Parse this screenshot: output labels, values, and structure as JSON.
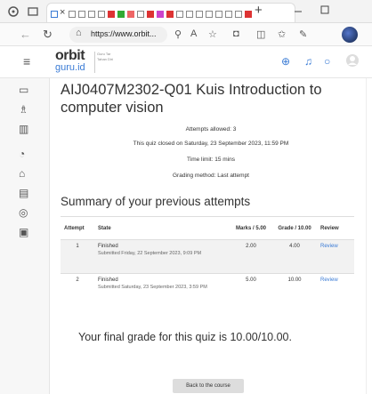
{
  "browser": {
    "tab_close": "×",
    "new_tab": "+",
    "url": "https://www.orbit..."
  },
  "site": {
    "logo_top": "orbit",
    "logo_bottom": "guru.id",
    "logo_tagline": "Guru Tar Tahan Diri"
  },
  "quiz": {
    "title": "AIJ0407M2302-Q01 Kuis Introduction to computer vision",
    "attempts_allowed": "Attempts allowed: 3",
    "closed_on": "This quiz closed on Saturday, 23 September 2023, 11:59 PM",
    "time_limit": "Time limit: 15 mins",
    "grading_method": "Grading method: Last attempt"
  },
  "summary": {
    "heading": "Summary of your previous attempts",
    "columns": [
      "Attempt",
      "State",
      "Marks / 5.00",
      "Grade / 10.00",
      "Review"
    ],
    "rows": [
      {
        "attempt": "1",
        "state": "Finished",
        "submitted": "Submitted Friday, 22 September 2023, 9:09 PM",
        "marks": "2.00",
        "grade": "4.00",
        "review": "Review"
      },
      {
        "attempt": "2",
        "state": "Finished",
        "submitted": "Submitted Saturday, 23 September 2023, 3:59 PM",
        "marks": "5.00",
        "grade": "10.00",
        "review": "Review"
      }
    ]
  },
  "final_grade": "Your final grade for this quiz is 10.00/10.00.",
  "back_button": "Back to the course",
  "colors": {
    "accent": "#3a7bd5",
    "row_stripe": "#f2f2f2"
  }
}
